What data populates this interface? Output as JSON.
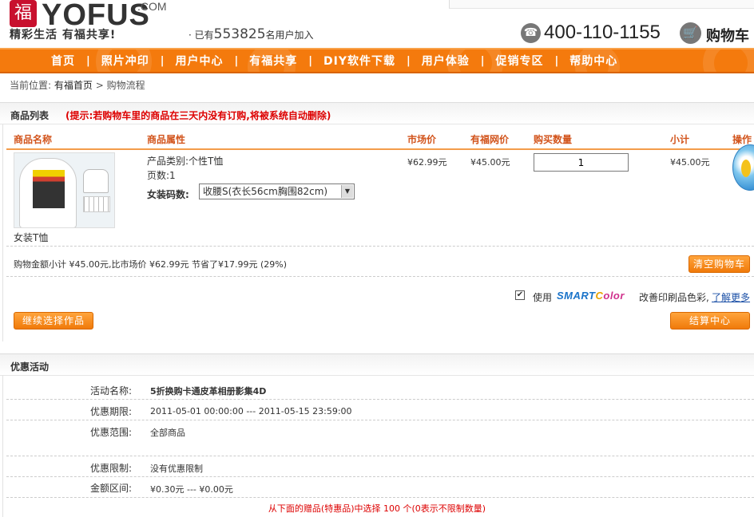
{
  "header": {
    "logo_char": "福",
    "logo_text": "YOFUS",
    "logo_suffix": ".COM",
    "slogan": "精彩生活 有福共享!",
    "users_prefix": "· 已有",
    "users_count": "553825",
    "users_suffix": "名用户加入",
    "phone": "400-110-1155",
    "cart_label": "购物车"
  },
  "nav": {
    "items": [
      "首页",
      "照片冲印",
      "用户中心",
      "有福共享",
      "DIY软件下载",
      "用户体验",
      "促销专区",
      "帮助中心"
    ],
    "separator": "|"
  },
  "breadcrumb": {
    "prefix": "当前位置:",
    "home": "有福首页",
    "sep": ">",
    "current": "购物流程"
  },
  "product_list": {
    "title": "商品列表",
    "tip": "(提示:若购物车里的商品在三天内没有订购,将被系统自动删除)",
    "columns": {
      "name": "商品名称",
      "attributes": "商品属性",
      "market_price": "市场价",
      "yofus_price": "有福网价",
      "quantity": "购买数量",
      "subtotal": "小计",
      "action": "操作"
    },
    "item": {
      "name": "女装T恤",
      "category": "产品类别:个性T恤",
      "pages": "页数:1",
      "size_label": "女装码数:",
      "size_value": "收腰S(衣长56cm胸围82cm)",
      "market_price": "¥62.99元",
      "yofus_price": "¥45.00元",
      "quantity": "1",
      "subtotal": "¥45.00元"
    },
    "summary": "购物金额小计 ¥45.00元,比市场价 ¥62.99元 节省了¥17.99元 (29%)",
    "clear_button": "清空购物车",
    "smartcolor": {
      "use": "使用",
      "brand_a": "SMART",
      "brand_b": "C",
      "brand_c": "olor",
      "improve": "改善印刷品色彩,",
      "learn_more": "了解更多",
      "checked": true
    },
    "continue_button": "继续选择作品",
    "checkout_button": "结算中心"
  },
  "promotion": {
    "title": "优惠活动",
    "rows": [
      {
        "label": "活动名称:",
        "value": "5折换购卡通皮革相册影集4D"
      },
      {
        "label": "优惠期限:",
        "value": "2011-05-01 00:00:00 --- 2011-05-15 23:59:00"
      },
      {
        "label": "优惠范围:",
        "value": "全部商品"
      },
      {
        "label": "优惠限制:",
        "value": "没有优惠限制"
      },
      {
        "label": "金额区间:",
        "value": "¥0.30元 --- ¥0.00元"
      }
    ],
    "note": "从下面的赠品(特惠品)中选择 100 个(0表示不限制数量)"
  },
  "colors": {
    "nav_orange": "#f47a0d",
    "header_accent": "#d2541c",
    "tip_red": "#dd0000",
    "link_blue": "#1a4fa6"
  }
}
